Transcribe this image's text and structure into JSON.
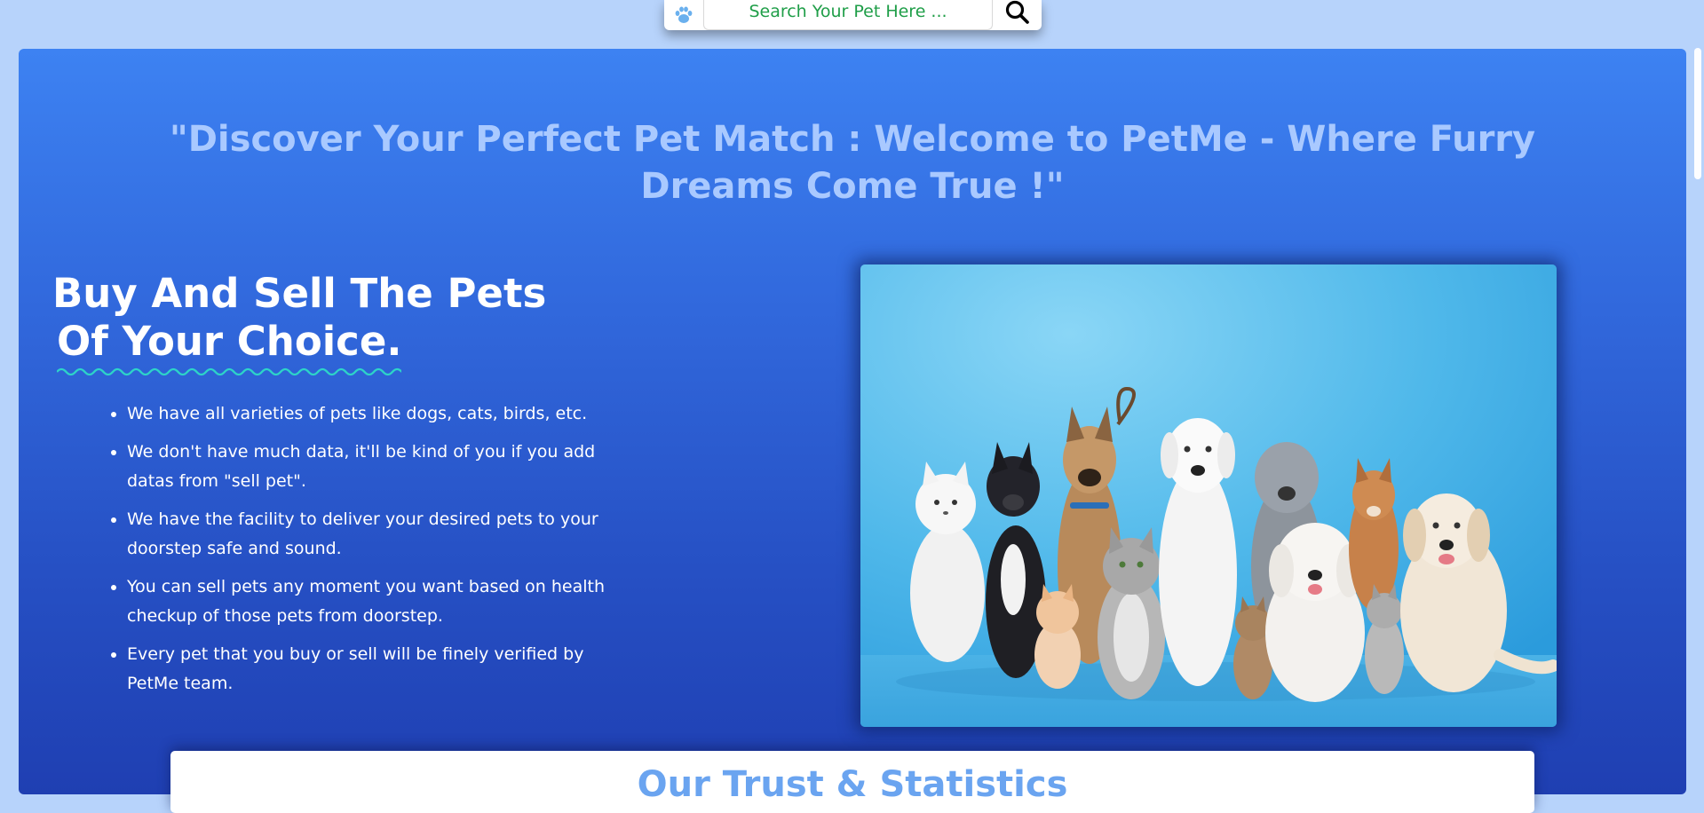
{
  "search": {
    "placeholder": "Search Your Pet Here ...",
    "paw_icon": "paw-icon",
    "search_icon": "search-icon"
  },
  "hero": {
    "tagline": "\"Discover Your Perfect Pet Match : Welcome to PetMe - Where Furry Dreams Come True !\"",
    "heading_line1": "Buy And Sell The Pets",
    "heading_line2": "Of Your Choice.",
    "features": [
      "We have all varieties of pets like dogs, cats, birds, etc.",
      "We don't have much data, it'll be kind of you if you add datas from \"sell pet\".",
      "We have the facility to deliver your desired pets to your doorstep safe and sound.",
      "You can sell pets any moment you want based on health checkup of those pets from doorstep.",
      "Every pet that you buy or sell will be finely verified by PetMe team."
    ]
  },
  "stats": {
    "title": "Our Trust & Statistics"
  },
  "colors": {
    "page_bg": "#b7d3fb",
    "hero_top": "#3d82f2",
    "hero_bottom": "#1f3fb2",
    "tagline": "#a9c9ff",
    "squiggle": "#2dd4c8",
    "search_text": "#1f9e48",
    "stats_title": "#6aa4f0"
  }
}
